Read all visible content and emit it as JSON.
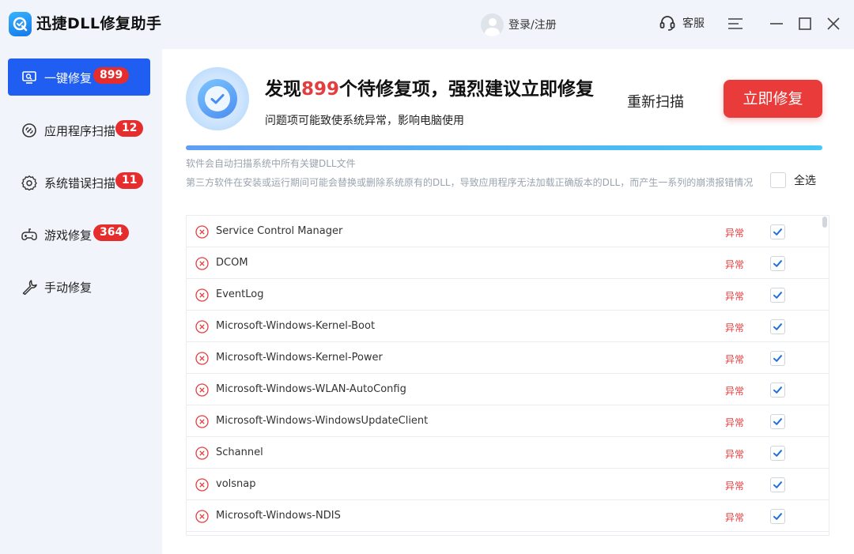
{
  "app": {
    "title": "迅捷DLL修复助手"
  },
  "header": {
    "login_label": "登录/注册",
    "service_label": "客服"
  },
  "sidebar": {
    "items": [
      {
        "label": "一键修复",
        "badge": "899",
        "active": true,
        "icon": "monitor-icon"
      },
      {
        "label": "应用程序扫描",
        "badge": "12",
        "active": false,
        "icon": "link-icon"
      },
      {
        "label": "系统错误扫描",
        "badge": "11",
        "active": false,
        "icon": "gear-icon"
      },
      {
        "label": "游戏修复",
        "badge": "364",
        "active": false,
        "icon": "gamepad-icon"
      },
      {
        "label": "手动修复",
        "badge": "",
        "active": false,
        "icon": "wrench-icon"
      }
    ]
  },
  "main": {
    "headline_pre": "发现",
    "headline_count": "899",
    "headline_post": "个待修复项，强烈建议立即修复",
    "subline": "问题项可能致使系统异常，影响电脑使用",
    "rescan_label": "重新扫描",
    "fix_label": "立即修复",
    "progress_fraction": 1.0,
    "note1": "软件会自动扫描系统中所有关键DLL文件",
    "note2": "第三方软件在安装或运行期间可能会替换或删除系统原有的DLL，导致应用程序无法加载正确版本的DLL，而产生一系列的崩溃报错情况",
    "select_all_label": "全选",
    "select_all_checked": false
  },
  "list": {
    "items": [
      {
        "name": "Service Control Manager",
        "status": "异常",
        "checked": true
      },
      {
        "name": "DCOM",
        "status": "异常",
        "checked": true
      },
      {
        "name": "EventLog",
        "status": "异常",
        "checked": true
      },
      {
        "name": "Microsoft-Windows-Kernel-Boot",
        "status": "异常",
        "checked": true
      },
      {
        "name": "Microsoft-Windows-Kernel-Power",
        "status": "异常",
        "checked": true
      },
      {
        "name": "Microsoft-Windows-WLAN-AutoConfig",
        "status": "异常",
        "checked": true
      },
      {
        "name": "Microsoft-Windows-WindowsUpdateClient",
        "status": "异常",
        "checked": true
      },
      {
        "name": "Schannel",
        "status": "异常",
        "checked": true
      },
      {
        "name": "volsnap",
        "status": "异常",
        "checked": true
      },
      {
        "name": "Microsoft-Windows-NDIS",
        "status": "异常",
        "checked": true
      }
    ]
  },
  "colors": {
    "accent": "#1f5ef0",
    "danger": "#e43d3d",
    "check": "#1f6fe0"
  }
}
